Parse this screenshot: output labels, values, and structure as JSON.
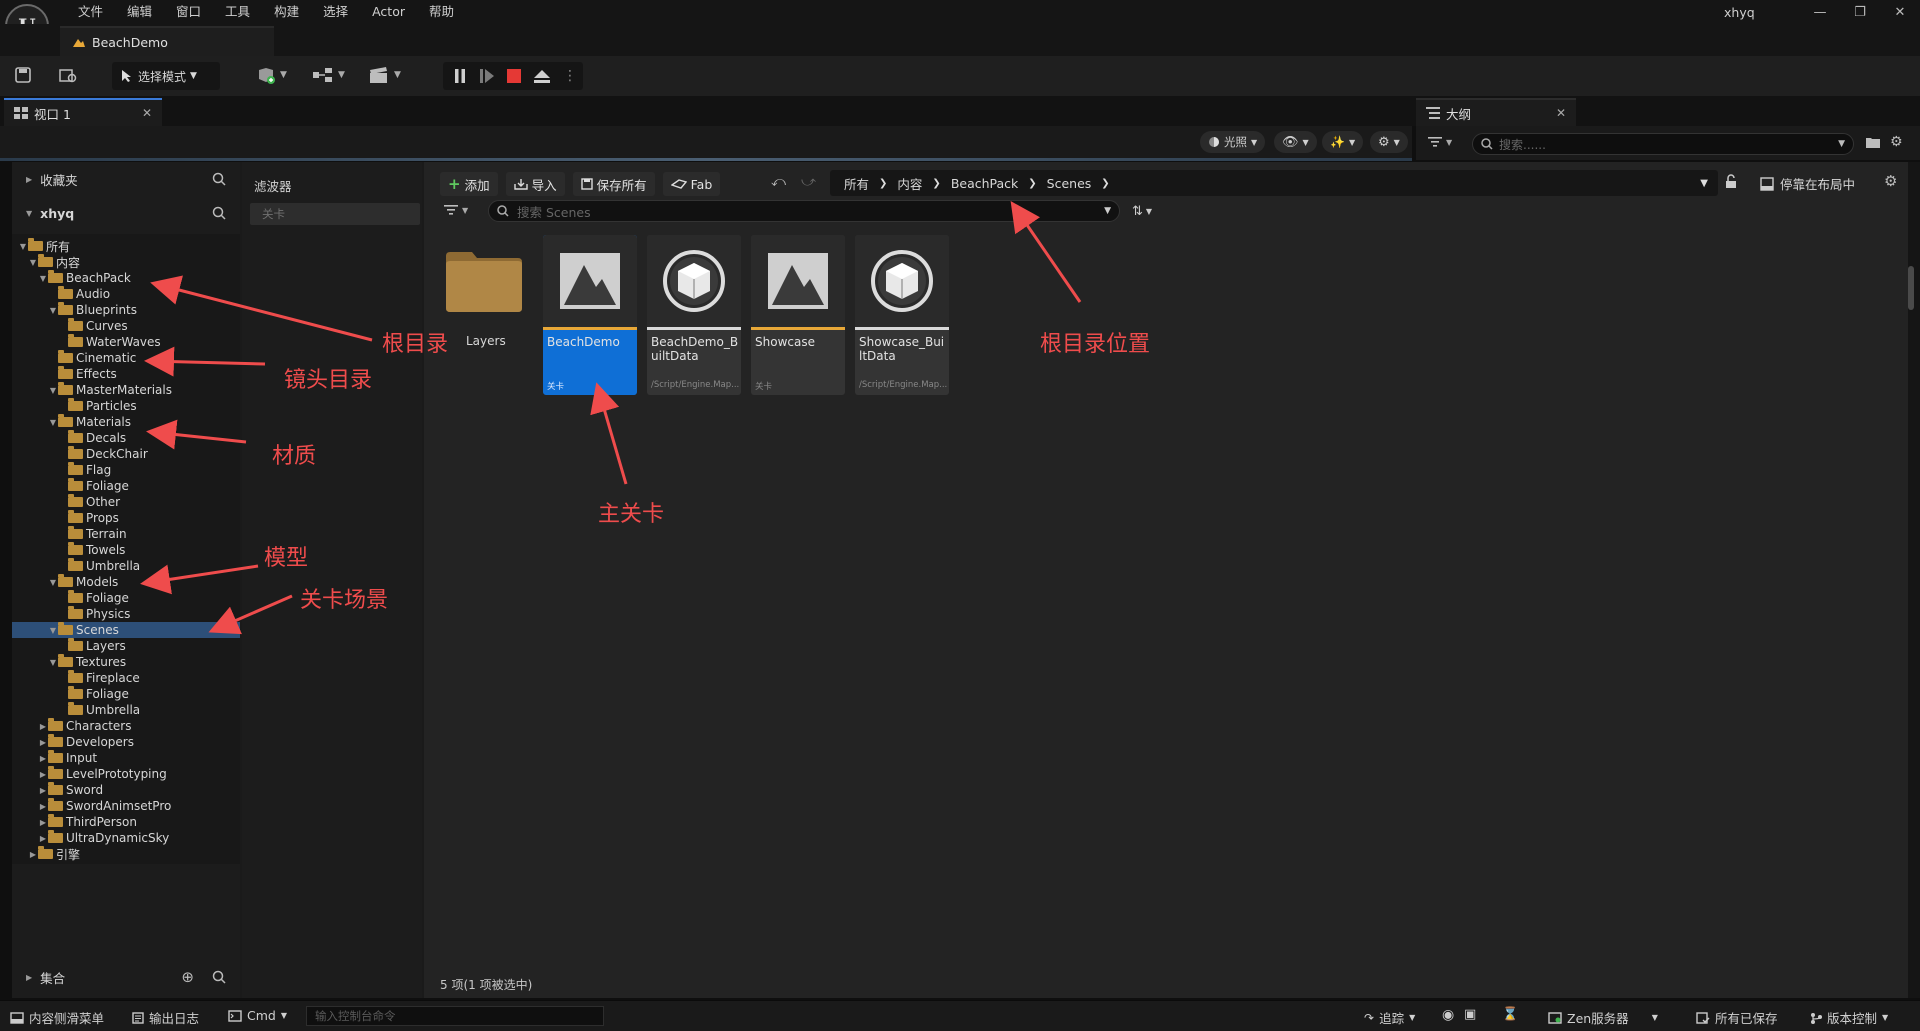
{
  "app": {
    "user": "xhyq",
    "logo": "U"
  },
  "menu": [
    "文件",
    "编辑",
    "窗口",
    "工具",
    "构建",
    "选择",
    "Actor",
    "帮助"
  ],
  "doc_tab": {
    "label": "BeachDemo"
  },
  "toolbar": {
    "mode_label": "选择模式"
  },
  "panel_tabs": {
    "viewport": "视口 1",
    "outliner": "大纲"
  },
  "viewport_buttons": {
    "lighting": "光照"
  },
  "outliner": {
    "search_placeholder": "搜索......"
  },
  "left": {
    "favorites": "收藏夹",
    "project": "xhyq",
    "collections": "集合",
    "tree": [
      {
        "label": "所有",
        "depth": 0,
        "open": true
      },
      {
        "label": "内容",
        "depth": 1,
        "open": true
      },
      {
        "label": "BeachPack",
        "depth": 2,
        "open": true
      },
      {
        "label": "Audio",
        "depth": 3
      },
      {
        "label": "Blueprints",
        "depth": 3,
        "open": true
      },
      {
        "label": "Curves",
        "depth": 4
      },
      {
        "label": "WaterWaves",
        "depth": 4
      },
      {
        "label": "Cinematic",
        "depth": 3
      },
      {
        "label": "Effects",
        "depth": 3
      },
      {
        "label": "MasterMaterials",
        "depth": 3,
        "open": true
      },
      {
        "label": "Particles",
        "depth": 4
      },
      {
        "label": "Materials",
        "depth": 3,
        "open": true
      },
      {
        "label": "Decals",
        "depth": 4
      },
      {
        "label": "DeckChair",
        "depth": 4
      },
      {
        "label": "Flag",
        "depth": 4
      },
      {
        "label": "Foliage",
        "depth": 4
      },
      {
        "label": "Other",
        "depth": 4
      },
      {
        "label": "Props",
        "depth": 4
      },
      {
        "label": "Terrain",
        "depth": 4
      },
      {
        "label": "Towels",
        "depth": 4
      },
      {
        "label": "Umbrella",
        "depth": 4
      },
      {
        "label": "Models",
        "depth": 3,
        "open": true
      },
      {
        "label": "Foliage",
        "depth": 4
      },
      {
        "label": "Physics",
        "depth": 4
      },
      {
        "label": "Scenes",
        "depth": 3,
        "open": true,
        "selected": true
      },
      {
        "label": "Layers",
        "depth": 4
      },
      {
        "label": "Textures",
        "depth": 3,
        "open": true
      },
      {
        "label": "Fireplace",
        "depth": 4
      },
      {
        "label": "Foliage",
        "depth": 4
      },
      {
        "label": "Umbrella",
        "depth": 4
      },
      {
        "label": "Characters",
        "depth": 2,
        "closed": true
      },
      {
        "label": "Developers",
        "depth": 2,
        "closed": true
      },
      {
        "label": "Input",
        "depth": 2,
        "closed": true
      },
      {
        "label": "LevelPrototyping",
        "depth": 2,
        "closed": true
      },
      {
        "label": "Sword",
        "depth": 2,
        "closed": true
      },
      {
        "label": "SwordAnimsetPro",
        "depth": 2,
        "closed": true
      },
      {
        "label": "ThirdPerson",
        "depth": 2,
        "closed": true
      },
      {
        "label": "UltraDynamicSky",
        "depth": 2,
        "closed": true
      },
      {
        "label": "引擎",
        "depth": 1,
        "closed": true
      }
    ]
  },
  "filters": {
    "title": "滤波器",
    "placeholder": "关卡"
  },
  "content_toolbar": {
    "add": "添加",
    "import": "导入",
    "save_all": "保存所有",
    "fab": "Fab",
    "dock": "停靠在布局中"
  },
  "breadcrumb": [
    "所有",
    "内容",
    "BeachPack",
    "Scenes"
  ],
  "content_search": {
    "placeholder": "搜索 Scenes"
  },
  "assets": [
    {
      "name": "Layers",
      "type": "folder"
    },
    {
      "name": "BeachDemo",
      "sub": "关卡",
      "type": "level",
      "selected": true,
      "bar": "#e8a838"
    },
    {
      "name": "BeachDemo_BuiltData",
      "sub": "/Script/Engine.Map...",
      "type": "data",
      "bar": "#d9d9d9"
    },
    {
      "name": "Showcase",
      "sub": "关卡",
      "type": "level",
      "bar": "#e8a838"
    },
    {
      "name": "Showcase_BuiltData",
      "sub": "/Script/Engine.Map...",
      "type": "data",
      "bar": "#d9d9d9"
    }
  ],
  "status_count": "5 项(1 项被选中)",
  "annotations": {
    "root": "根目录",
    "cinematic": "镜头目录",
    "material": "材质",
    "model": "模型",
    "level_scene": "关卡场景",
    "main_level": "主关卡",
    "root_location": "根目录位置"
  },
  "statusbar": {
    "content_drawer": "内容侧滑菜单",
    "output_log": "输出日志",
    "cmd": "Cmd",
    "console_placeholder": "输入控制台命令",
    "trace": "追踪",
    "zen": "Zen服务器",
    "saved": "所有已保存",
    "version": "版本控制"
  },
  "colors": {
    "accent": "#0f6fd6",
    "annotation": "#ef4c4c",
    "folder": "#b98d3a"
  }
}
